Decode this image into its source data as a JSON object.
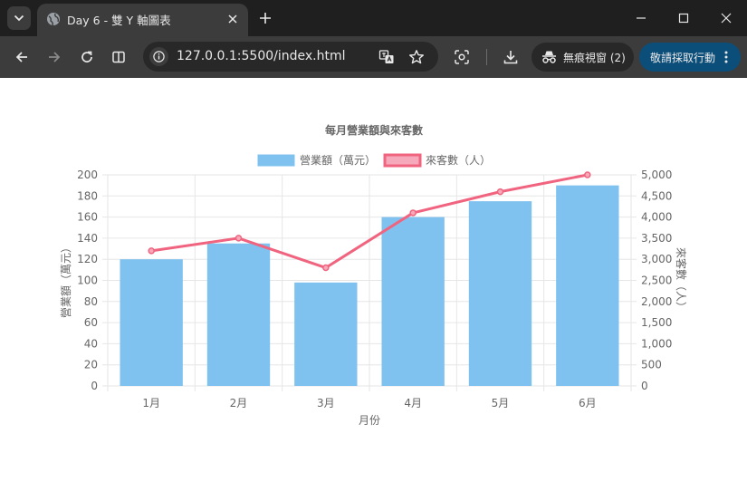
{
  "browser": {
    "tab_title": "Day 6 - 雙 Y 軸圖表",
    "url": "127.0.0.1:5500/index.html",
    "incognito_label": "無痕視窗 (2)",
    "action_label": "敬請採取行動"
  },
  "chart_data": {
    "type": "bar",
    "title": "每月營業額與來客數",
    "xlabel": "月份",
    "categories": [
      "1月",
      "2月",
      "3月",
      "4月",
      "5月",
      "6月"
    ],
    "series": [
      {
        "name": "營業額（萬元）",
        "type": "bar",
        "axis": "left",
        "color": "#7fc1ef",
        "values": [
          120,
          135,
          98,
          160,
          175,
          190
        ]
      },
      {
        "name": "來客數（人）",
        "type": "line",
        "axis": "right",
        "color": "#f0647f",
        "values": [
          3200,
          3500,
          2800,
          4100,
          4600,
          5000
        ]
      }
    ],
    "y_left": {
      "label": "營業額（萬元）",
      "range": [
        0,
        200
      ],
      "ticks": [
        "0",
        "20",
        "40",
        "60",
        "80",
        "100",
        "120",
        "140",
        "160",
        "180",
        "200"
      ]
    },
    "y_right": {
      "label": "來客數（人）",
      "range": [
        0,
        5000
      ],
      "ticks": [
        "0",
        "500",
        "1,000",
        "1,500",
        "2,000",
        "2,500",
        "3,000",
        "3,500",
        "4,000",
        "4,500",
        "5,000"
      ]
    },
    "legend": "top",
    "grid": true
  }
}
